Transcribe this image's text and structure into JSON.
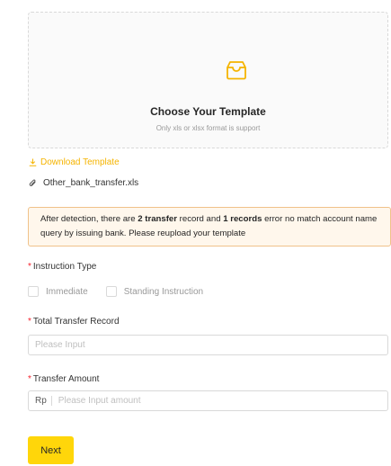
{
  "upload": {
    "icon": "inbox-icon",
    "title": "Choose Your Template",
    "subtitle": "Only xls or xlsx format is support"
  },
  "download_template": {
    "icon": "download-icon",
    "label": "Download Template"
  },
  "file": {
    "icon": "paperclip-icon",
    "name": "Other_bank_transfer.xls"
  },
  "alert": {
    "part1": "After detection, there are ",
    "bold1": "2 transfer",
    "part2": " record and ",
    "bold2": "1 records",
    "part3": " error no match account name query by issuing bank. Please reupload your template"
  },
  "instruction_type": {
    "required_mark": "*",
    "label": "Instruction Type",
    "options": [
      "Immediate",
      "Standing Instruction"
    ]
  },
  "total_transfer_record": {
    "required_mark": "*",
    "label": "Total Transfer Record",
    "placeholder": "Please Input"
  },
  "transfer_amount": {
    "required_mark": "*",
    "label": "Transfer Amount",
    "prefix": "Rp",
    "placeholder": "Please Input amount"
  },
  "next_button": {
    "label": "Next"
  },
  "colors": {
    "accent": "#ffd60a",
    "link": "#f5b400",
    "required": "#f5222d",
    "alert_bg": "#fff7ec",
    "alert_border": "#f0c28a"
  }
}
